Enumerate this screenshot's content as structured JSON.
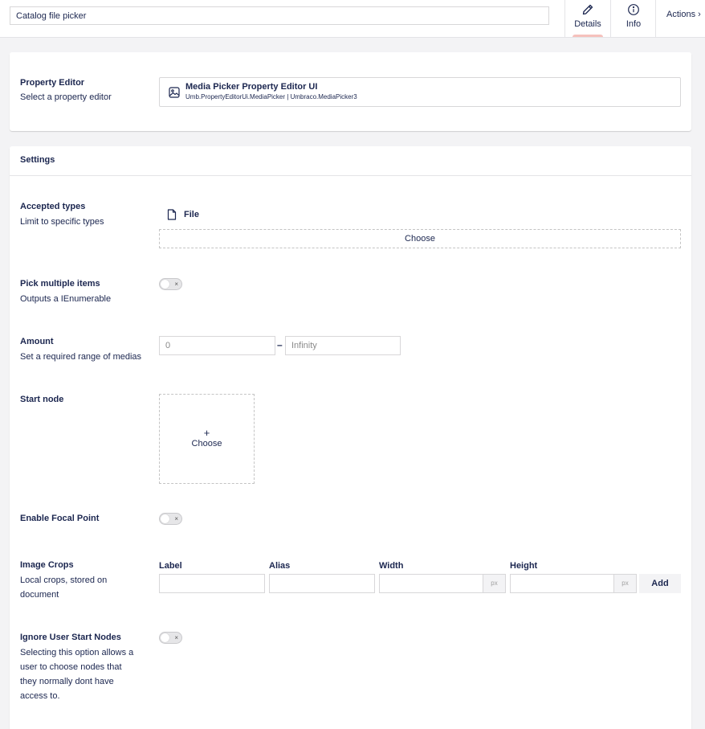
{
  "header": {
    "name_value": "Catalog file picker",
    "tabs": [
      {
        "label": "Details",
        "icon": "pencil-icon",
        "active": true
      },
      {
        "label": "Info",
        "icon": "info-icon",
        "active": false
      }
    ],
    "actions_label": "Actions",
    "actions_chevron": "›"
  },
  "colors": {
    "accent_underline": "#f5c1bc",
    "text": "#1b264f",
    "background": "#f3f3f5"
  },
  "property_editor": {
    "label": "Property Editor",
    "description": "Select a property editor",
    "editor_name": "Media Picker Property Editor UI",
    "editor_alias": "Umb.PropertyEditorUi.MediaPicker | Umbraco.MediaPicker3"
  },
  "settings": {
    "title": "Settings",
    "accepted_types": {
      "label": "Accepted types",
      "description": "Limit to specific types",
      "items": [
        "File"
      ],
      "choose_label": "Choose"
    },
    "pick_multiple": {
      "label": "Pick multiple items",
      "description": "Outputs a IEnumerable",
      "toggle_symbol": "×"
    },
    "amount": {
      "label": "Amount",
      "description": "Set a required range of medias",
      "min_placeholder": "0",
      "max_placeholder": "Infinity",
      "separator": "–"
    },
    "start_node": {
      "label": "Start node",
      "plus": "+",
      "choose_label": "Choose"
    },
    "focal_point": {
      "label": "Enable Focal Point",
      "toggle_symbol": "×"
    },
    "image_crops": {
      "label": "Image Crops",
      "description_line1": "Local crops, stored on",
      "description_line2": "document",
      "columns": {
        "label": "Label",
        "alias": "Alias",
        "width": "Width",
        "height": "Height"
      },
      "unit": "px",
      "add_label": "Add"
    },
    "ignore_start_nodes": {
      "label": "Ignore User Start Nodes",
      "description_lines": [
        "Selecting this option allows a",
        "user to choose nodes that",
        "they normally dont have",
        "access to."
      ],
      "toggle_symbol": "×"
    }
  }
}
